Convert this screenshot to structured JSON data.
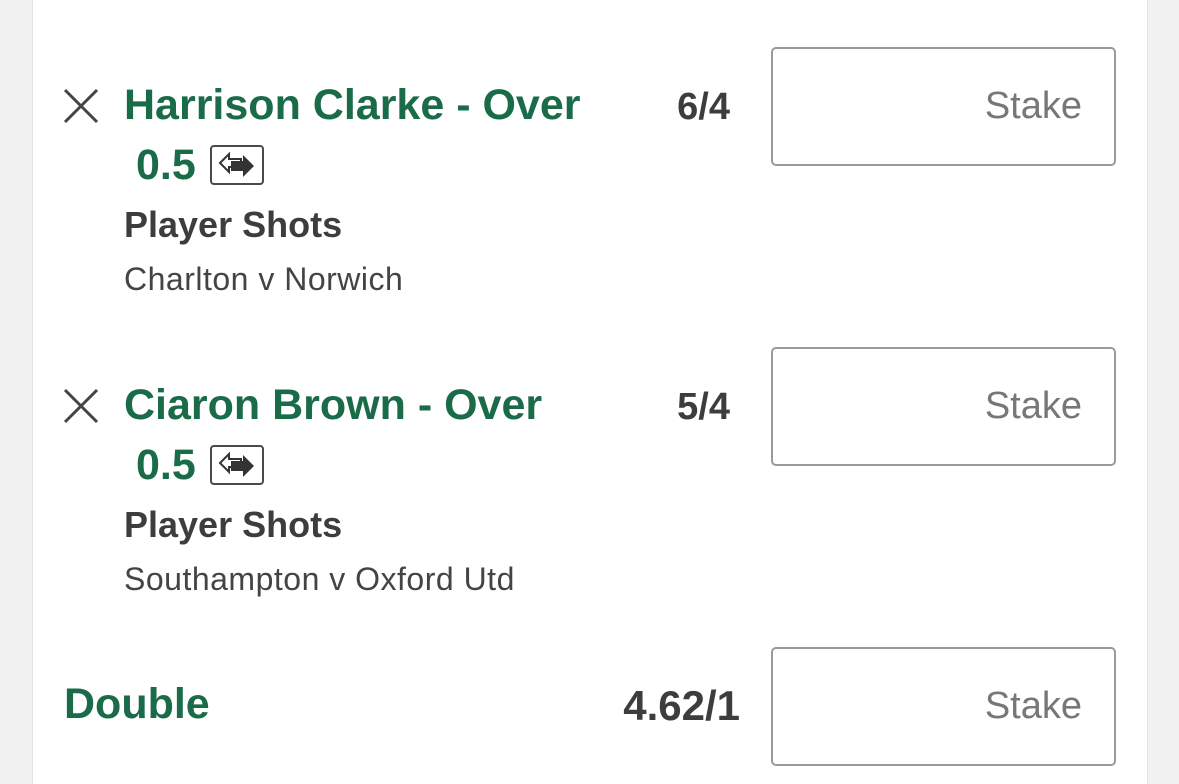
{
  "bets": [
    {
      "selection_line1": "Harrison Clarke - Over",
      "selection_line2": "0.5",
      "market": "Player Shots",
      "event": "Charlton v Norwich",
      "odds": "6/4",
      "stake_placeholder": "Stake"
    },
    {
      "selection_line1": "Ciaron Brown - Over",
      "selection_line2": "0.5",
      "market": "Player Shots",
      "event": "Southampton v Oxford Utd",
      "odds": "5/4",
      "stake_placeholder": "Stake"
    }
  ],
  "multiple": {
    "label": "Double",
    "odds": "4.62/1",
    "stake_placeholder": "Stake"
  },
  "icons": {
    "remove": "close-icon",
    "bet_builder": "swap-arrow-icon"
  },
  "colors": {
    "accent_green": "#1a6b47",
    "text_dark": "#3d3d3d",
    "background": "#f1f1f1"
  }
}
